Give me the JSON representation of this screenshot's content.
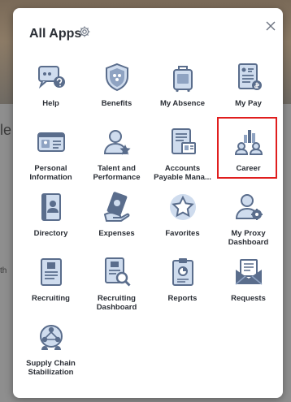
{
  "header": {
    "title": "All Apps",
    "settings_icon": "gear-icon",
    "close_icon": "close-icon"
  },
  "background": {
    "left_fragment_1": "le",
    "left_fragment_2": "th"
  },
  "apps": [
    {
      "id": "help",
      "label": "Help",
      "icon": "help-chat-icon"
    },
    {
      "id": "benefits",
      "label": "Benefits",
      "icon": "shield-icon"
    },
    {
      "id": "my-absence",
      "label": "My Absence",
      "icon": "luggage-icon"
    },
    {
      "id": "my-pay",
      "label": "My Pay",
      "icon": "pay-document-icon"
    },
    {
      "id": "personal-information",
      "label": "Personal Information",
      "icon": "id-card-icon"
    },
    {
      "id": "talent-and-performance",
      "label": "Talent and Performance",
      "icon": "person-star-icon"
    },
    {
      "id": "accounts-payable",
      "label": "Accounts Payable Mana...",
      "icon": "invoice-icon"
    },
    {
      "id": "career",
      "label": "Career",
      "icon": "career-people-icon",
      "selected": true
    },
    {
      "id": "directory",
      "label": "Directory",
      "icon": "address-book-icon"
    },
    {
      "id": "expenses",
      "label": "Expenses",
      "icon": "money-hand-icon"
    },
    {
      "id": "favorites",
      "label": "Favorites",
      "icon": "star-icon"
    },
    {
      "id": "my-proxy-dashboard",
      "label": "My Proxy Dashboard",
      "icon": "person-gear-icon"
    },
    {
      "id": "recruiting",
      "label": "Recruiting",
      "icon": "resume-icon"
    },
    {
      "id": "recruiting-dashboard",
      "label": "Recruiting Dashboard",
      "icon": "resume-search-icon"
    },
    {
      "id": "reports",
      "label": "Reports",
      "icon": "report-chart-icon"
    },
    {
      "id": "requests",
      "label": "Requests",
      "icon": "envelope-icon"
    },
    {
      "id": "supply-chain-stabilization",
      "label": "Supply Chain Stabilization",
      "icon": "network-people-icon"
    }
  ],
  "colors": {
    "selected_border": "#e01e1e",
    "icon_dark": "#5a6d8c",
    "icon_light": "#cfdcee"
  }
}
